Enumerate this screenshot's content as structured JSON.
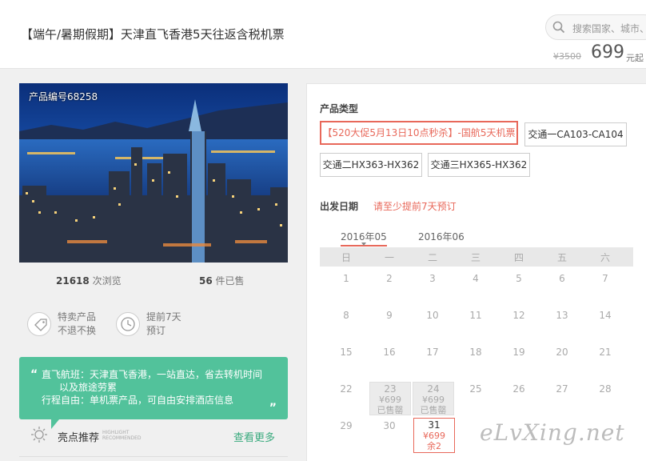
{
  "header": {
    "title": "【端午/暑期假期】天津直飞香港5天往返含税机票",
    "search_placeholder": "搜索国家、城市、",
    "price_original": "¥3500",
    "price_current": "699",
    "price_unit": "元起"
  },
  "product": {
    "code_label": "产品编号68258",
    "views_count": "21618",
    "views_label": "次浏览",
    "sold_count": "56",
    "sold_label": "件已售",
    "features": [
      {
        "icon": "tag-icon",
        "line1": "特卖产品",
        "line2": "不退不换"
      },
      {
        "icon": "clock-icon",
        "line1": "提前7天",
        "line2": "预订"
      }
    ],
    "highlights": {
      "open_quote": "“",
      "close_quote": "”",
      "lines": [
        "直飞航班：天津直飞香港，一站直达，省去转机时间",
        "以及旅途劳累",
        "行程自由：单机票产品，可自由安排酒店信息"
      ],
      "label": "亮点推荐",
      "label_en_1": "HIGHLIGHT",
      "label_en_2": "RECOMMENDED",
      "more_link": "查看更多"
    }
  },
  "booking": {
    "type_label": "产品类型",
    "options": [
      {
        "label": "【520大促5月13日10点秒杀】-国航5天机票",
        "selected": true
      },
      {
        "label": "交通一CA103-CA104",
        "selected": false
      },
      {
        "label": "交通二HX363-HX362",
        "selected": false
      },
      {
        "label": "交通三HX365-HX362",
        "selected": false
      }
    ],
    "date_label": "出发日期",
    "notice": "请至少提前7天预订",
    "months": [
      "2016年05",
      "2016年06"
    ],
    "weekdays": [
      "日",
      "一",
      "二",
      "三",
      "四",
      "五",
      "六"
    ],
    "calendar": {
      "days_row1": [
        "1",
        "2",
        "3",
        "4",
        "5",
        "6",
        "7"
      ],
      "days_row2": [
        "8",
        "9",
        "10",
        "11",
        "12",
        "13",
        "14"
      ],
      "days_row3": [
        "15",
        "16",
        "17",
        "18",
        "19",
        "20",
        "21"
      ],
      "days_row4": [
        "22",
        "25",
        "26",
        "27",
        "28"
      ],
      "days_row5": [
        "29",
        "30"
      ],
      "sold_out": [
        {
          "day": "23",
          "price": "¥699",
          "status": "已售罄"
        },
        {
          "day": "24",
          "price": "¥699",
          "status": "已售罄"
        }
      ],
      "available": {
        "day": "31",
        "price": "¥699",
        "status": "余2"
      }
    }
  },
  "watermark": "eLvXing.net",
  "colors": {
    "accent": "#e8685a",
    "green": "#52c29b",
    "link": "#3aaa7e"
  }
}
